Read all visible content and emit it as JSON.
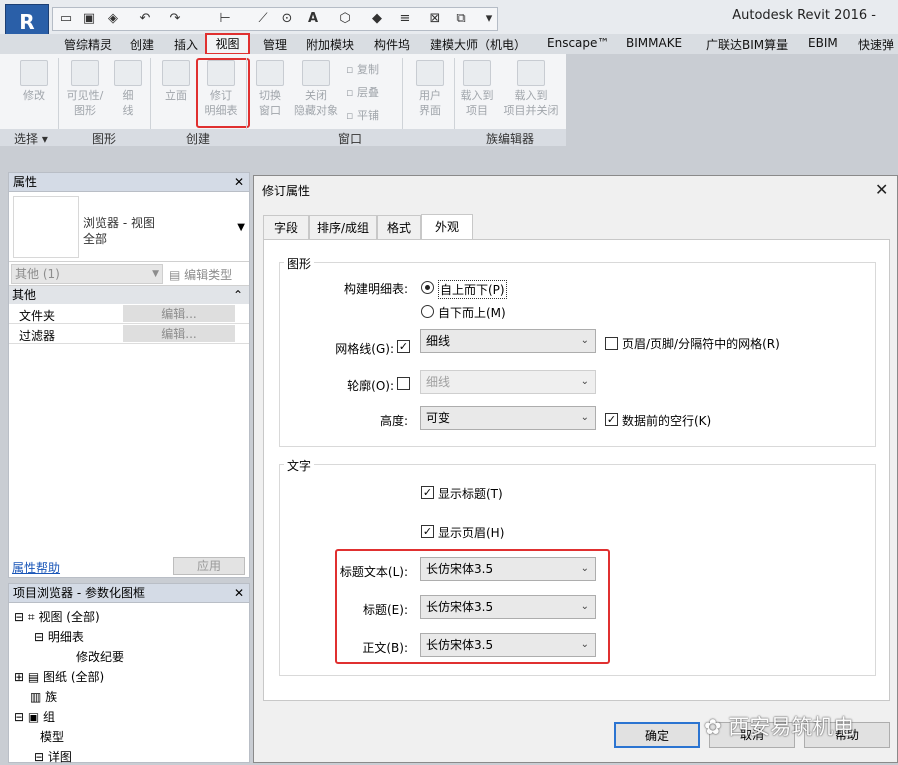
{
  "app": {
    "title": "Autodesk Revit 2016 -"
  },
  "ribbon_tabs": [
    "管综精灵",
    "创建",
    "插入",
    "视图",
    "管理",
    "附加模块",
    "构件坞",
    "建模大师（机电）",
    "Enscape™",
    "BIMMAKE",
    "广联达BIM算量",
    "EBIM",
    "快速弹"
  ],
  "ribbon": {
    "buttons": [
      "修改",
      "可见性/\n图形",
      "细\n线",
      "立面",
      "修订\n明细表",
      "切换\n窗口",
      "关闭\n隐藏对象",
      "复制",
      "层叠",
      "平铺",
      "用户\n界面",
      "载入到\n项目",
      "载入到\n项目并关闭"
    ],
    "groups": [
      "选择 ▾",
      "图形",
      "创建",
      "窗口",
      "族编辑器"
    ]
  },
  "properties": {
    "title": "属性",
    "type_name": "浏览器 - 视图",
    "type_sub": "全部",
    "filter": "其他 (1)",
    "edit_type": "编辑类型",
    "section": "其他",
    "rows": [
      {
        "name": "文件夹",
        "value": "编辑..."
      },
      {
        "name": "过滤器",
        "value": "编辑..."
      }
    ],
    "help": "属性帮助",
    "apply": "应用"
  },
  "browser": {
    "title": "项目浏览器 - 参数化图框",
    "items": [
      "视图 (全部)",
      "明细表",
      "修改纪要",
      "图纸 (全部)",
      "族",
      "组",
      "模型",
      "详图"
    ]
  },
  "dialog": {
    "title": "修订属性",
    "tabs": [
      "字段",
      "排序/成组",
      "格式",
      "外观"
    ],
    "graphics": {
      "legend": "图形",
      "build_label": "构建明细表:",
      "opt1": "自上而下(P)",
      "opt2": "自下而上(M)",
      "grid_label": "网格线(G):",
      "grid_value": "细线",
      "grid_extra": "页眉/页脚/分隔符中的网格(R)",
      "outline_label": "轮廓(O):",
      "outline_value": "细线",
      "height_label": "高度:",
      "height_value": "可变",
      "blank_row": "数据前的空行(K)"
    },
    "text": {
      "legend": "文字",
      "show_title": "显示标题(T)",
      "show_header": "显示页眉(H)",
      "title_text_label": "标题文本(L):",
      "title_text_value": "长仿宋体3.5",
      "title_label": "标题(E):",
      "title_value": "长仿宋体3.5",
      "body_label": "正文(B):",
      "body_value": "长仿宋体3.5"
    },
    "buttons": {
      "ok": "确定",
      "cancel": "取消",
      "help": "帮助"
    }
  },
  "watermark": "西安易筑机电"
}
